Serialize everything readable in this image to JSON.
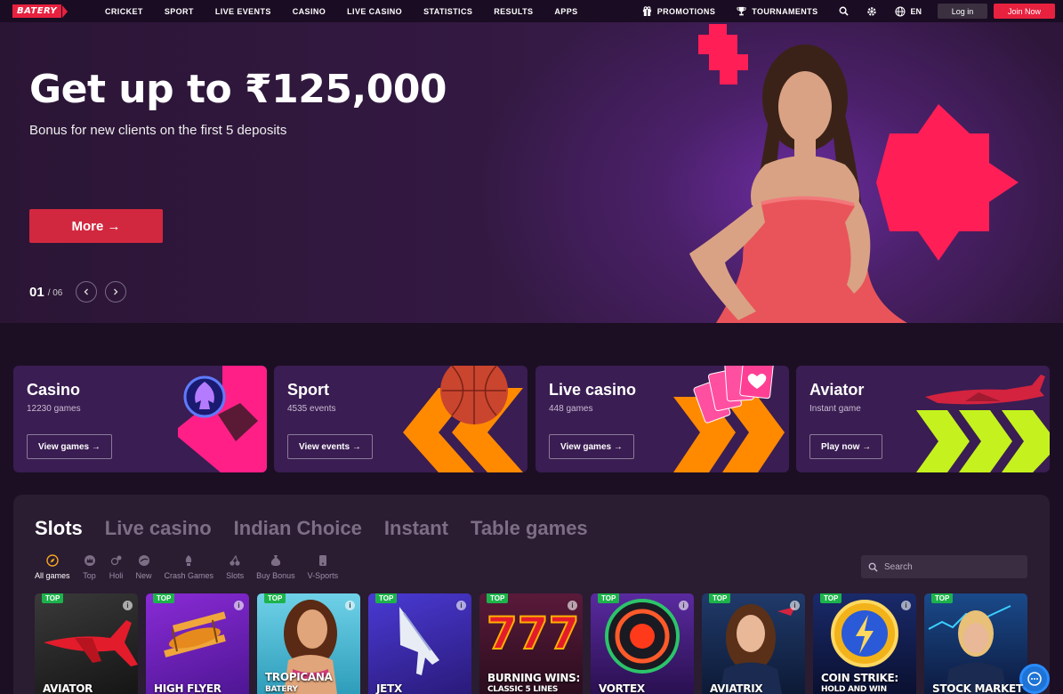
{
  "brand": {
    "name": "BATERY",
    "accent": "#e8213f",
    "bg": "#1c0f24"
  },
  "nav": {
    "links": [
      "CRICKET",
      "SPORT",
      "LIVE EVENTS",
      "CASINO",
      "LIVE CASINO",
      "STATISTICS",
      "RESULTS",
      "APPS"
    ],
    "promotions": "PROMOTIONS",
    "tournaments": "TOURNAMENTS",
    "language": "EN",
    "login": "Log in",
    "join": "Join Now"
  },
  "hero": {
    "title": "Get up to ₹125,000",
    "subtitle": "Bonus for new clients on the first 5 deposits",
    "button": "More →",
    "slide_current": "01",
    "slide_total": "/ 06"
  },
  "categories": [
    {
      "title": "Casino",
      "sub": "12230 games",
      "button": "View games →"
    },
    {
      "title": "Sport",
      "sub": "4535 events",
      "button": "View events →"
    },
    {
      "title": "Live casino",
      "sub": "448 games",
      "button": "View games →"
    },
    {
      "title": "Aviator",
      "sub": "Instant game",
      "button": "Play now →"
    }
  ],
  "games": {
    "tabs": [
      "Slots",
      "Live casino",
      "Indian Choice",
      "Instant",
      "Table games"
    ],
    "filters": [
      "All games",
      "Top",
      "Holi",
      "New",
      "Crash Games",
      "Slots",
      "Buy Bonus",
      "V-Sports"
    ],
    "search_placeholder": "Search",
    "badge": "TOP",
    "info": "i",
    "tiles": [
      {
        "name": "AVIATOR",
        "sub": ""
      },
      {
        "name": "HIGH FLYER",
        "sub": ""
      },
      {
        "name": "TROPICANA",
        "sub": "BATERY"
      },
      {
        "name": "JETX",
        "sub": ""
      },
      {
        "name": "BURNING WINS:",
        "sub": "CLASSIC 5 LINES"
      },
      {
        "name": "VORTEX",
        "sub": ""
      },
      {
        "name": "AVIATRIX",
        "sub": ""
      },
      {
        "name": "COIN STRIKE:",
        "sub": "HOLD AND WIN"
      },
      {
        "name": "STOCK MARKET",
        "sub": ""
      }
    ]
  }
}
